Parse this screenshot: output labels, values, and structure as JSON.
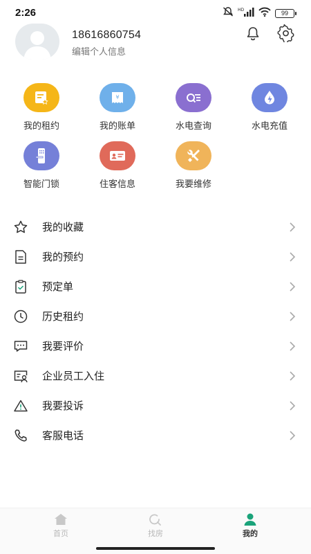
{
  "status_bar": {
    "time": "2:26",
    "network_label": "HD",
    "battery": "99"
  },
  "profile": {
    "phone": "18616860754",
    "edit_label": "编辑个人信息"
  },
  "grid": [
    {
      "label": "我的租约",
      "icon": "contract-icon",
      "color": "#f5b618"
    },
    {
      "label": "我的账单",
      "icon": "bill-icon",
      "color": "#6fb0ea"
    },
    {
      "label": "水电查询",
      "icon": "search-list-icon",
      "color": "#8a6fd0"
    },
    {
      "label": "水电充值",
      "icon": "water-drop-icon",
      "color": "#6f86e0"
    },
    {
      "label": "智能门锁",
      "icon": "door-lock-icon",
      "color": "#7580d8"
    },
    {
      "label": "住客信息",
      "icon": "id-card-icon",
      "color": "#e06a5a"
    },
    {
      "label": "我要维修",
      "icon": "tools-icon",
      "color": "#f0b45a"
    }
  ],
  "menu": [
    {
      "label": "我的收藏",
      "icon": "star-icon"
    },
    {
      "label": "我的预约",
      "icon": "document-icon"
    },
    {
      "label": "预定单",
      "icon": "clipboard-icon"
    },
    {
      "label": "历史租约",
      "icon": "clock-icon"
    },
    {
      "label": "我要评价",
      "icon": "comment-icon"
    },
    {
      "label": "企业员工入住",
      "icon": "employee-card-icon"
    },
    {
      "label": "我要投诉",
      "icon": "warning-icon"
    },
    {
      "label": "客服电话",
      "icon": "phone-icon"
    }
  ],
  "tabs": [
    {
      "label": "首页",
      "icon": "home-icon",
      "active": false
    },
    {
      "label": "找房",
      "icon": "search-icon",
      "active": false
    },
    {
      "label": "我的",
      "icon": "user-icon",
      "active": true
    }
  ],
  "colors": {
    "accent": "#1aa37a",
    "tab_inactive": "#c8c8c8"
  }
}
